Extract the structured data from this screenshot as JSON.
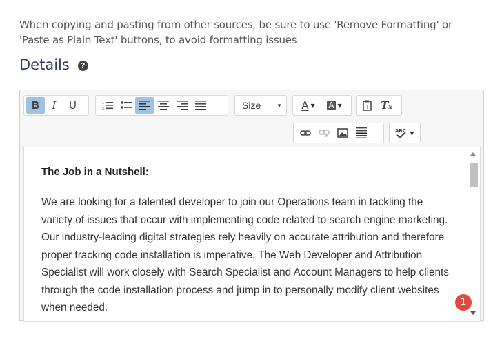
{
  "notice": "When copying and pasting from other sources, be sure to use 'Remove Formatting' or 'Paste as Plain Text' buttons, to avoid formatting issues",
  "details": {
    "title": "Details",
    "help_icon": "?"
  },
  "toolbar": {
    "bold": "B",
    "italic": "I",
    "underline": "U",
    "size_label": "Size",
    "text_color": "A",
    "bg_color": "A"
  },
  "content": {
    "heading": "The Job in a Nutshell:",
    "paragraph": "We are looking for a talented developer to join our Operations team in tackling the variety of issues that occur with implementing code related to search engine marketing. Our industry-leading digital strategies rely heavily on accurate attribution and therefore proper tracking code installation is imperative. The Web Developer and Attribution Specialist will work closely with Search Specialist and Account Managers to help clients through the code installation process and jump in to personally modify client websites when needed."
  },
  "badge": {
    "count": "1"
  },
  "colors": {
    "active_button": "#9fc2e3",
    "title": "#2d3e6b",
    "badge": "#e04a3f"
  }
}
